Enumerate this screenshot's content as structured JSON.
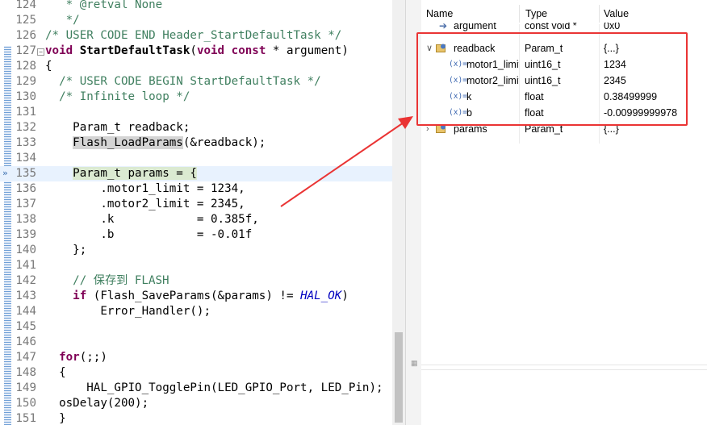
{
  "editor": {
    "lines": [
      {
        "num": "124",
        "tokens": [
          {
            "t": "   * ",
            "c": "cm"
          },
          {
            "t": "@retval",
            "c": "cm"
          },
          {
            "t": " None",
            "c": "cm"
          }
        ]
      },
      {
        "num": "125",
        "tokens": [
          {
            "t": "   */",
            "c": "cm"
          }
        ]
      },
      {
        "num": "126",
        "tokens": [
          {
            "t": "/* USER CODE END Header_StartDefaultTask */",
            "c": "cm"
          }
        ]
      },
      {
        "num": "127",
        "fold": "−",
        "tokens": [
          {
            "t": "void",
            "c": "kw"
          },
          {
            "t": " "
          },
          {
            "t": "StartDefaultTask",
            "c": "fn"
          },
          {
            "t": "("
          },
          {
            "t": "void",
            "c": "kw"
          },
          {
            "t": " "
          },
          {
            "t": "const",
            "c": "kw"
          },
          {
            "t": " * argument)"
          }
        ]
      },
      {
        "num": "128",
        "tokens": [
          {
            "t": "{"
          }
        ]
      },
      {
        "num": "129",
        "tokens": [
          {
            "t": "  /* USER CODE BEGIN StartDefaultTask */",
            "c": "cm"
          }
        ]
      },
      {
        "num": "130",
        "tokens": [
          {
            "t": "  /* Infinite loop */",
            "c": "cm"
          }
        ]
      },
      {
        "num": "131",
        "tokens": []
      },
      {
        "num": "132",
        "tokens": [
          {
            "t": "    Param_t readback;"
          }
        ]
      },
      {
        "num": "133",
        "tokens": [
          {
            "t": "    "
          },
          {
            "t": "Flash_LoadParams",
            "c": "hl"
          },
          {
            "t": "(&readback);"
          }
        ]
      },
      {
        "num": "134",
        "tokens": []
      },
      {
        "num": "135",
        "current": true,
        "bp": true,
        "tokens": [
          {
            "t": "    "
          },
          {
            "t": "Param_t params = {",
            "c": "marked"
          }
        ]
      },
      {
        "num": "136",
        "tokens": [
          {
            "t": "        .motor1_limit = 1234,"
          }
        ]
      },
      {
        "num": "137",
        "tokens": [
          {
            "t": "        .motor2_limit = 2345,"
          }
        ]
      },
      {
        "num": "138",
        "tokens": [
          {
            "t": "        .k            = 0.385f,"
          }
        ]
      },
      {
        "num": "139",
        "tokens": [
          {
            "t": "        .b            = -0.01f"
          }
        ]
      },
      {
        "num": "140",
        "tokens": [
          {
            "t": "    };"
          }
        ]
      },
      {
        "num": "141",
        "tokens": []
      },
      {
        "num": "142",
        "tokens": [
          {
            "t": "    // 保存到 FLASH",
            "c": "cm"
          }
        ]
      },
      {
        "num": "143",
        "tokens": [
          {
            "t": "    "
          },
          {
            "t": "if",
            "c": "kw"
          },
          {
            "t": " (Flash_SaveParams(&params) != "
          },
          {
            "t": "HAL_OK",
            "c": "it"
          },
          {
            "t": ")"
          }
        ]
      },
      {
        "num": "144",
        "tokens": [
          {
            "t": "        Error_Handler();"
          }
        ]
      },
      {
        "num": "145",
        "tokens": []
      },
      {
        "num": "146",
        "tokens": []
      },
      {
        "num": "147",
        "tokens": [
          {
            "t": "  "
          },
          {
            "t": "for",
            "c": "kw"
          },
          {
            "t": "(;;)"
          }
        ]
      },
      {
        "num": "148",
        "tokens": [
          {
            "t": "  {"
          }
        ]
      },
      {
        "num": "149",
        "tokens": [
          {
            "t": "      HAL_GPIO_TogglePin(LED_GPIO_Port, LED_Pin);"
          }
        ]
      },
      {
        "num": "150",
        "tokens": [
          {
            "t": "  osDelay(200);"
          }
        ]
      },
      {
        "num": "151",
        "tokens": [
          {
            "t": "  }"
          }
        ]
      }
    ]
  },
  "variables": {
    "columns": {
      "name": "Name",
      "type": "Type",
      "value": "Value"
    },
    "rows": [
      {
        "indent": 1,
        "icon": "arrow",
        "name": "argument",
        "type": "const void *",
        "value": "0x0",
        "struck": true
      },
      {
        "indent": 0,
        "twisty": "∨",
        "icon": "struct",
        "name": "readback",
        "type": "Param_t",
        "value": "{...}"
      },
      {
        "indent": 1,
        "icon": "var",
        "name": "motor1_limit",
        "type": "uint16_t",
        "value": "1234"
      },
      {
        "indent": 1,
        "icon": "var",
        "name": "motor2_limit",
        "type": "uint16_t",
        "value": "2345"
      },
      {
        "indent": 1,
        "icon": "var",
        "name": "k",
        "type": "float",
        "value": "0.38499999"
      },
      {
        "indent": 1,
        "icon": "var",
        "name": "b",
        "type": "float",
        "value": "-0.00999999978"
      },
      {
        "indent": 0,
        "twisty": "›",
        "icon": "struct",
        "name": "params",
        "type": "Param_t",
        "value": "{...}"
      }
    ],
    "var_icon_label": "(x)=",
    "icons": {
      "struct": "struct-icon",
      "var": "variable-icon",
      "arrow": "pointer-icon"
    }
  },
  "colors": {
    "highlight_box": "#ea3434",
    "comment": "#3f7f5f",
    "keyword": "#7f0055",
    "current_line": "#e8f2fe"
  }
}
